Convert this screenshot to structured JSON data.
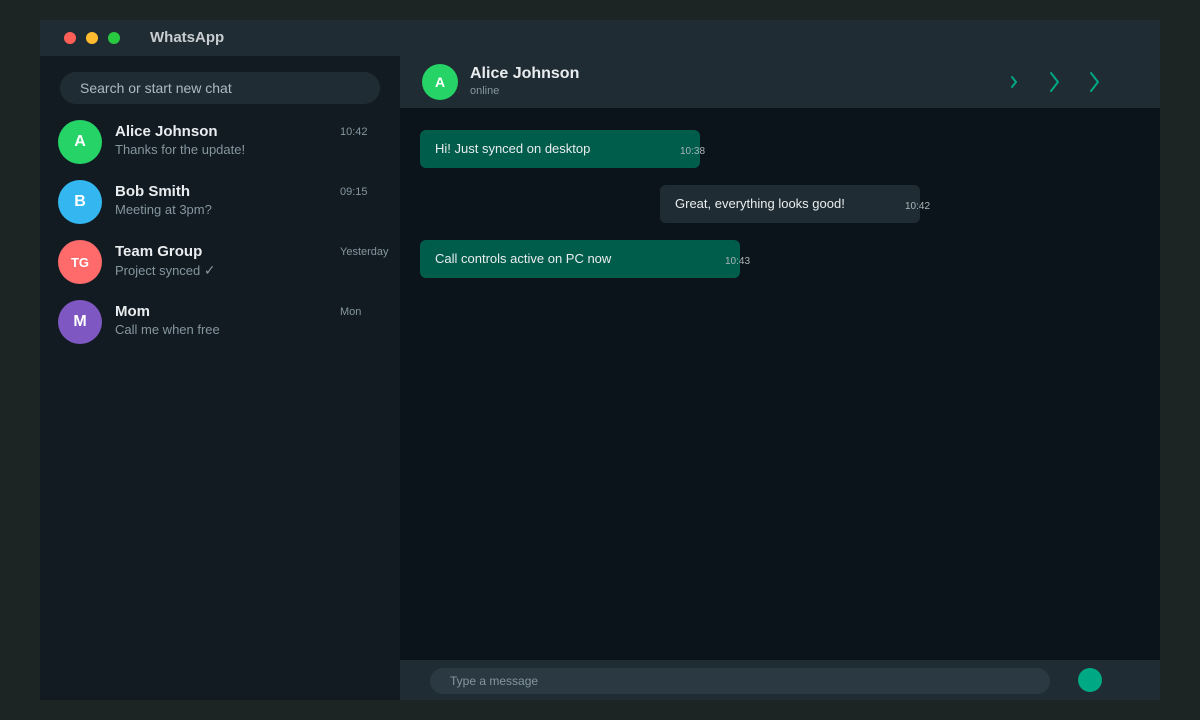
{
  "app": {
    "title": "WhatsApp"
  },
  "colors": {
    "accent": "#00a884",
    "outgoing_bubble": "#005c4b",
    "incoming_bubble": "#202c33",
    "panel": "#202c33",
    "background": "#0b141a"
  },
  "sidebar": {
    "search_placeholder": "Search or start new chat",
    "chats": [
      {
        "initials": "A",
        "name": "Alice Johnson",
        "preview": "Thanks for the update!",
        "time": "10:42",
        "avatar_color": "#25d366"
      },
      {
        "initials": "B",
        "name": "Bob Smith",
        "preview": "Meeting at 3pm?",
        "time": "09:15",
        "avatar_color": "#34b7f1"
      },
      {
        "initials": "TG",
        "name": "Team Group",
        "preview": "Project synced",
        "preview_suffix": "✓",
        "time": "Yesterday",
        "avatar_color": "#ff6b6b"
      },
      {
        "initials": "M",
        "name": "Mom",
        "preview": "Call me when free",
        "time": "Mon",
        "avatar_color": "#7e57c2"
      }
    ]
  },
  "chat": {
    "contact": {
      "initials": "A",
      "name": "Alice Johnson",
      "status": "online"
    },
    "header_icons": [
      "chevron-right-icon",
      "chevron-right-icon",
      "chevron-right-icon"
    ],
    "messages": [
      {
        "direction": "outgoing",
        "text": "Hi! Just synced on desktop",
        "time": "10:38"
      },
      {
        "direction": "incoming",
        "text": "Great, everything looks good!",
        "time": "10:42"
      },
      {
        "direction": "outgoing",
        "text": "Call controls active on PC now",
        "time": "10:43"
      }
    ],
    "composer": {
      "placeholder": "Type a message"
    }
  }
}
